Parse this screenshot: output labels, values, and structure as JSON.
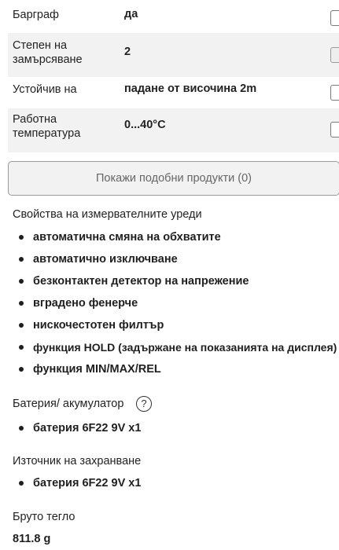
{
  "specs": [
    {
      "label": "Барграф",
      "value": "да"
    },
    {
      "label": "Степен на замърсяване",
      "value": "2"
    },
    {
      "label": "Устойчив на",
      "value": "падане от височина 2m"
    },
    {
      "label": "Работна температура",
      "value": "0...40°C"
    }
  ],
  "similar_button": "Покажи подобни продукти (0)",
  "meter_features": {
    "title": "Свойства на измервателните уреди",
    "items": [
      "автоматична смяна на обхватите",
      "автоматично изключване",
      "безконтактен детектор на напрежение",
      "вградено фенерче",
      "нискочестотен филтър",
      "функция HOLD (задържане на показанията на дисплея)",
      "функция MIN/MAX/REL"
    ]
  },
  "battery": {
    "title": "Батерия/ акумулатор",
    "help_glyph": "?",
    "items": [
      "батерия 6F22 9V x1"
    ]
  },
  "power_source": {
    "title": "Източник на захранване",
    "items": [
      "батерия 6F22 9V x1"
    ]
  },
  "gross_weight": {
    "title": "Бруто тегло",
    "value": "811.8 g"
  }
}
